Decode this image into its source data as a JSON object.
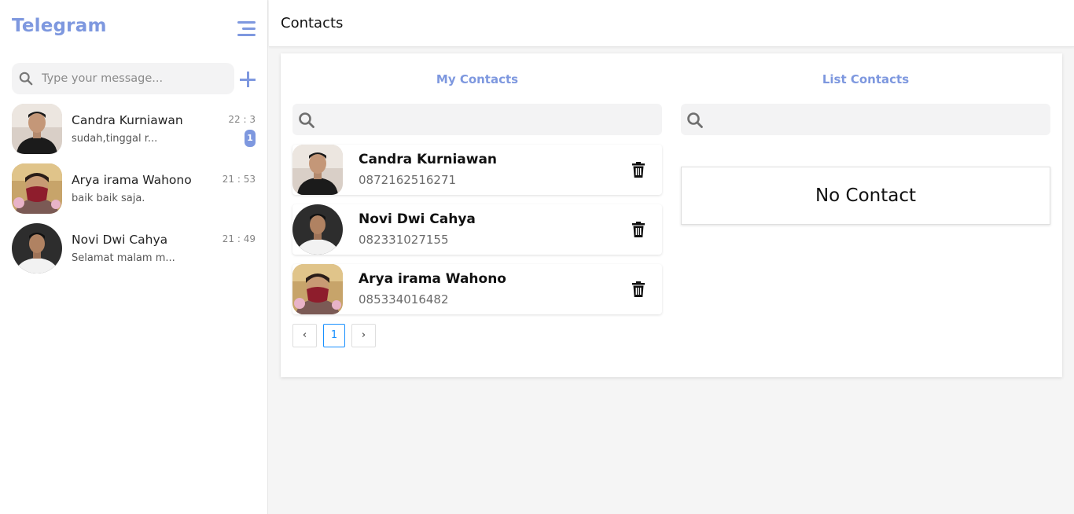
{
  "sidebar": {
    "brand": "Telegram",
    "search_placeholder": "Type your message...",
    "chats": [
      {
        "name": "Candra Kurniawan",
        "preview": "sudah,tinggal r...",
        "time": "22 : 3",
        "unread": "1"
      },
      {
        "name": "Arya irama Wahono",
        "preview": "baik baik saja.",
        "time": "21 : 53"
      },
      {
        "name": "Novi Dwi Cahya",
        "preview": "Selamat malam m...",
        "time": "21 : 49"
      }
    ]
  },
  "header": {
    "title": "Contacts"
  },
  "my_contacts": {
    "title": "My Contacts",
    "items": [
      {
        "name": "Candra Kurniawan",
        "phone": "0872162516271"
      },
      {
        "name": "Novi Dwi Cahya",
        "phone": "082331027155"
      },
      {
        "name": "Arya irama Wahono",
        "phone": "085334016482"
      }
    ],
    "pagination": {
      "prev": "‹",
      "current": "1",
      "next": "›"
    }
  },
  "list_contacts": {
    "title": "List Contacts",
    "empty_text": "No Contact"
  },
  "colors": {
    "accent": "#7e98df",
    "page_bg": "#f5f5f5",
    "pager_active": "#1890ff"
  },
  "icons": [
    "menu-icon",
    "search-icon",
    "plus-icon",
    "trash-icon"
  ]
}
